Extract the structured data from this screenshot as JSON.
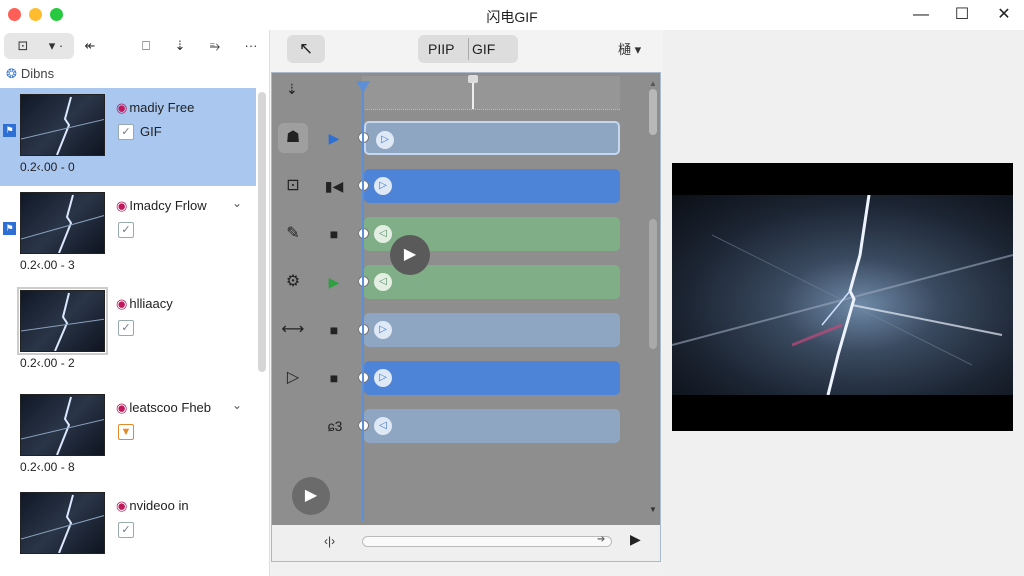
{
  "window": {
    "title": "闪电GIF",
    "minimize": "—",
    "maximize": "☐",
    "close": "✕"
  },
  "left_toolbar": {
    "btn1": "⊡",
    "btn2": "▾ ·",
    "btn3": "↞",
    "btn4": "⎕",
    "btn5": "⇣",
    "btn6": "⥱",
    "more": "···"
  },
  "left_panel": {
    "section_title": "Dibns",
    "items": [
      {
        "name": "madiy Free",
        "check": "✓",
        "gif_label": "GIF",
        "time": "0.2‹.00 - 0"
      },
      {
        "name": "Imadcy Frlow",
        "check": "✓",
        "time": "0.2‹.00 - 3"
      },
      {
        "name": "hlliaacy",
        "check": "✓",
        "time": "0.2‹.00 - 2"
      },
      {
        "name": "leatscoo Fheb",
        "check": "▼",
        "time": "0.2‹.00 - 8"
      },
      {
        "name": "nvideoo in",
        "check": "✓"
      }
    ]
  },
  "middle_toolbar": {
    "back": "↖",
    "seg1": "РІІР",
    "seg2": "GIF",
    "right_menu": "樋 ▾"
  },
  "timeline": {
    "ruler_icon": "⇣",
    "rows": [
      {
        "icon": "☗",
        "play": "▶",
        "marker": "▷"
      },
      {
        "icon": "⊡",
        "play": "▮◀",
        "marker": "▷"
      },
      {
        "icon": "✎",
        "play": "■",
        "marker": "◁"
      },
      {
        "icon": "⚙",
        "play": "▶",
        "marker": "◁"
      },
      {
        "icon": "⟷",
        "play": "■",
        "marker": "▷"
      },
      {
        "icon": "▷",
        "play": "■",
        "marker": "▷"
      },
      {
        "icon": "ɕ3",
        "marker": "◁"
      }
    ],
    "bottom_left": "‹|›",
    "bottom_play": "▶"
  },
  "colors": {
    "accent": "#2e6fd6",
    "selection": "#a9c7ef",
    "clip_blue": "#4d84d8",
    "clip_green": "#7fae87"
  }
}
